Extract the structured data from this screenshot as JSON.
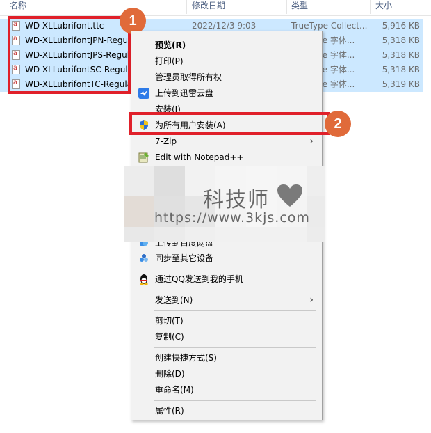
{
  "columns": {
    "name": "名称",
    "date": "修改日期",
    "type": "类型",
    "size": "大小"
  },
  "files": [
    {
      "name": "WD-XLLubrifont.ttc",
      "date": "2022/12/3 9:03",
      "type": "TrueType Collect...",
      "size": "5,916 KB"
    },
    {
      "name": "WD-XLLubrifontJPN-Regul",
      "date": "",
      "type": "pe 字体...",
      "size": "5,318 KB"
    },
    {
      "name": "WD-XLLubrifontJPS-Regul",
      "date": "",
      "type": "pe 字体...",
      "size": "5,318 KB"
    },
    {
      "name": "WD-XLLubrifontSC-Regula",
      "date": "",
      "type": "pe 字体...",
      "size": "5,318 KB"
    },
    {
      "name": "WD-XLLubrifontTC-Regula",
      "date": "",
      "type": "pe 字体...",
      "size": "5,319 KB"
    }
  ],
  "badges": {
    "one": "1",
    "two": "2"
  },
  "menu": {
    "preview": "预览(R)",
    "print": "打印(P)",
    "take_ownership": "管理员取得所有权",
    "upload_xunlei": "上传到迅雷云盘",
    "install": "安装(I)",
    "install_all_users": "为所有用户安装(A)",
    "zip": "7-Zip",
    "notepad": "Edit with Notepad++",
    "upload_baidu": "上传到百度网盘",
    "sync_devices": "同步至其它设备",
    "qq_send": "通过QQ发送到我的手机",
    "send_to": "发送到(N)",
    "cut": "剪切(T)",
    "copy": "复制(C)",
    "create_shortcut": "创建快捷方式(S)",
    "delete": "删除(D)",
    "rename": "重命名(M)",
    "properties": "属性(R)"
  },
  "watermark": {
    "brand": "科技师",
    "url": "https://www.3kjs.com"
  },
  "colors": {
    "selection": "#cce8ff",
    "highlight_box": "#e0202a",
    "badge": "#e06a3a",
    "menu_bg": "#f2f2f2"
  },
  "icons": [
    "file-font-icon",
    "xunlei-bird-icon",
    "uac-shield-icon",
    "notepad-icon",
    "baidu-cloud-icon",
    "sync-icon",
    "qq-penguin-icon",
    "chevron-right-icon",
    "heart-icon"
  ]
}
